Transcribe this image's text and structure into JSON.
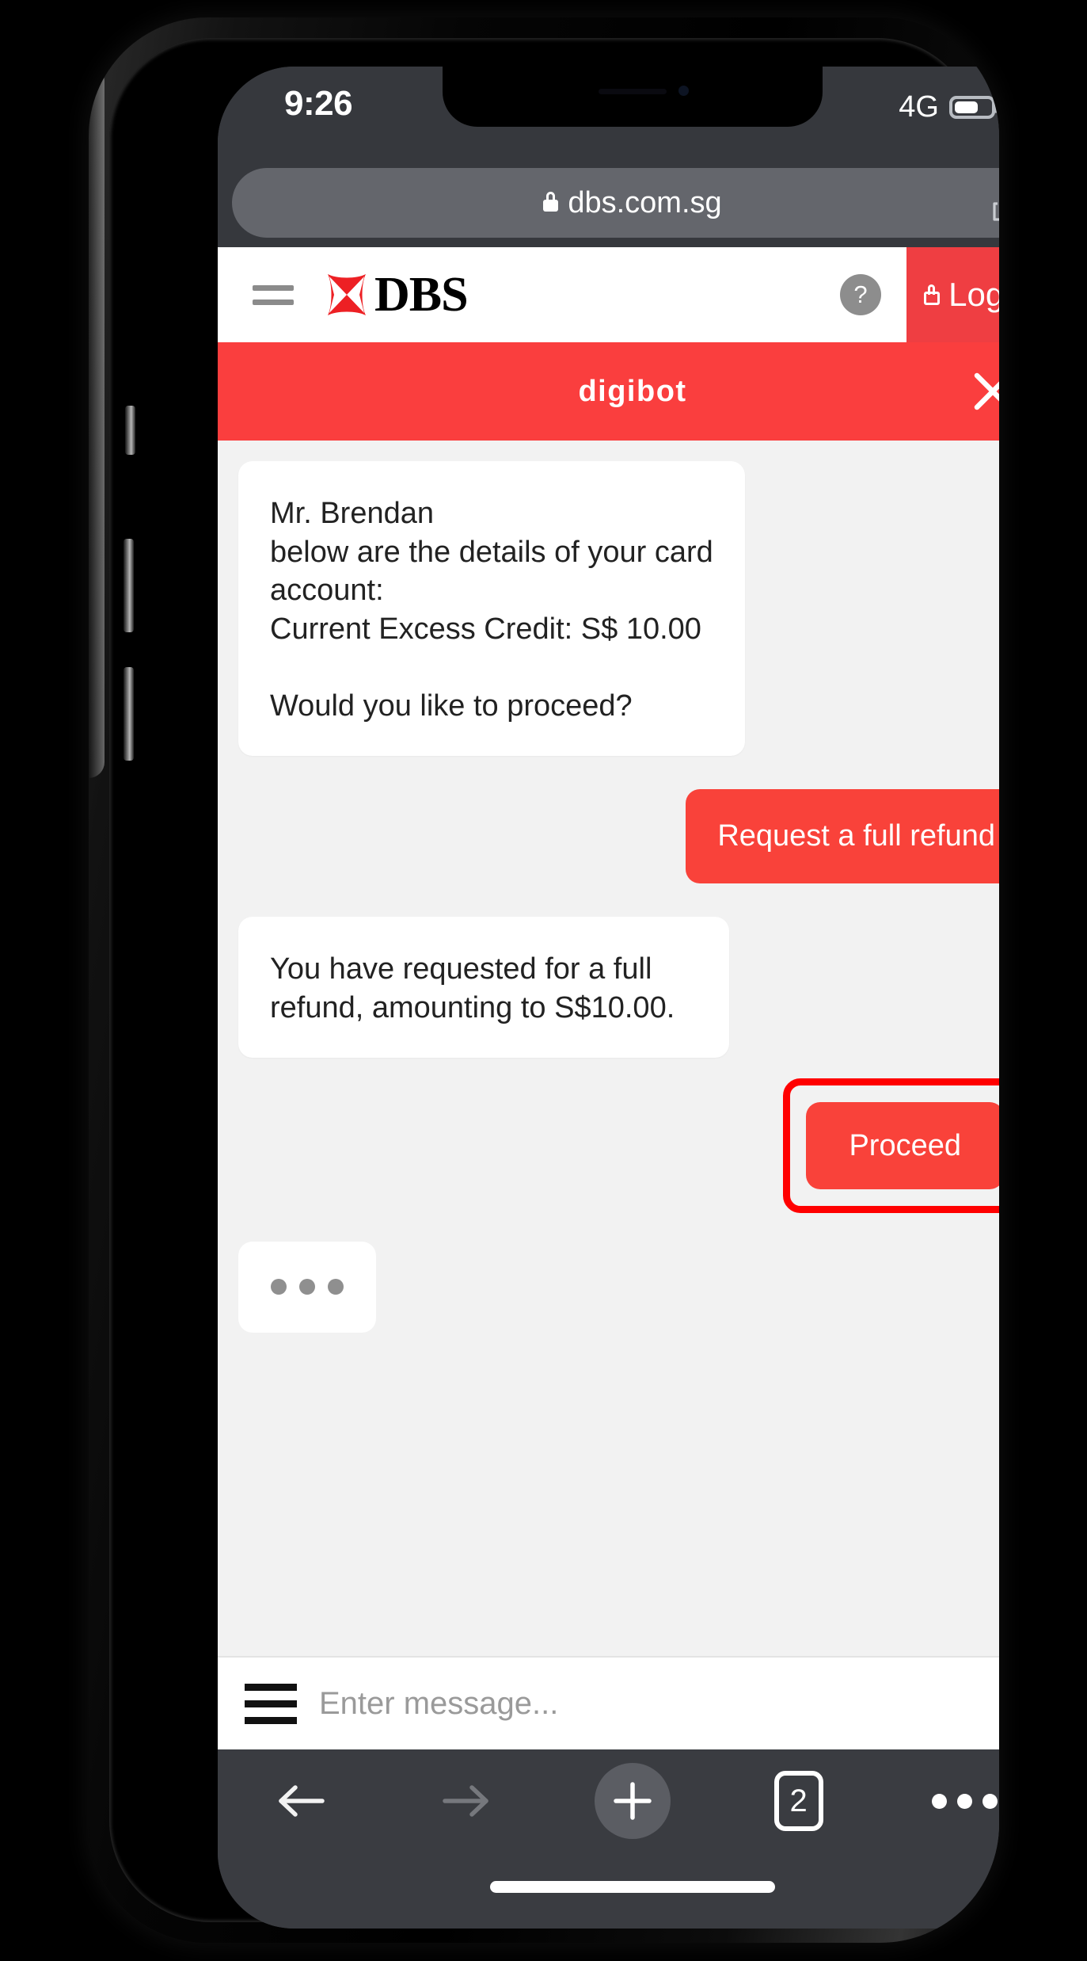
{
  "status_bar": {
    "time": "9:26",
    "network": "4G",
    "battery_percent": 65
  },
  "browser": {
    "url": "dbs.com.sg",
    "lock_icon": "lock-icon",
    "share_icon": "share-icon",
    "toolbar": {
      "back_icon": "arrow-left-icon",
      "forward_icon": "arrow-right-icon",
      "add_icon": "plus-icon",
      "tab_count": "2",
      "more_icon": "ellipsis-icon"
    }
  },
  "site_header": {
    "menu_icon": "hamburger-menu-icon",
    "logo_mark": "dbs-diamond-logo-icon",
    "logo_text": "DBS",
    "help_label": "?",
    "login_label": "Login",
    "login_lock_icon": "lock-icon",
    "brand_red": "#ef3e42"
  },
  "chat_widget": {
    "title": "digibot",
    "close_icon": "close-x-icon",
    "header_color": "#fa3e3e",
    "bubble_red": "#f9423a",
    "messages": [
      {
        "id": "bot-card-details",
        "sender": "bot",
        "text": "Mr. Brendan\nbelow are the details of your card account:\nCurrent Excess Credit: S$ 10.00\n\nWould you like to proceed?"
      },
      {
        "id": "user-request-refund",
        "sender": "user",
        "text": "Request a full refund"
      },
      {
        "id": "bot-refund-confirm",
        "sender": "bot",
        "text": "You have requested for a full refund, amounting to S$10.00."
      }
    ],
    "proceed_button": {
      "label": "Proceed",
      "highlighted": true,
      "highlight_color": "#ff0000"
    },
    "typing_indicator": {
      "icon": "typing-dots-icon",
      "dots": 3
    },
    "composer": {
      "menu_icon": "hamburger-menu-icon",
      "placeholder": "Enter message...",
      "value": ""
    }
  }
}
